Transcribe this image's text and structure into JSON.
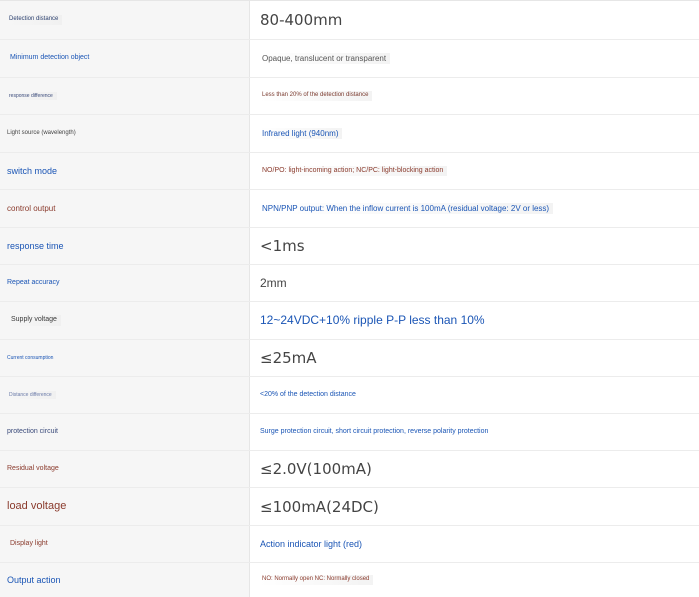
{
  "colors": {
    "blue": "#1a55b5",
    "brown": "#8a3a2c",
    "dark": "#333333"
  },
  "rows": [
    {
      "label": "Detection distance",
      "value": "80-400mm"
    },
    {
      "label": "Minimum detection object",
      "value": "Opaque, translucent or transparent"
    },
    {
      "label": "response difference",
      "value": "Less than 20% of the detection distance"
    },
    {
      "label": "Light source (wavelength)",
      "value": "Infrared light (940nm)"
    },
    {
      "label": "switch mode",
      "value": "NO/PO: light-incoming action; NC/PC: light-blocking action"
    },
    {
      "label": "control output",
      "value": "NPN/PNP output: When the inflow current is 100mA (residual voltage: 2V or less)"
    },
    {
      "label": "response time",
      "value": "<1ms"
    },
    {
      "label": "Repeat accuracy",
      "value": "2mm"
    },
    {
      "label": "Supply voltage",
      "value": "12~24VDC+10% ripple P-P less than 10%"
    },
    {
      "label": "Current consumption",
      "value": "≤25mA"
    },
    {
      "label": "Distance difference",
      "value": "<20% of the detection distance"
    },
    {
      "label": "protection circuit",
      "value": "Surge protection circuit, short circuit protection, reverse polarity protection"
    },
    {
      "label": "Residual voltage",
      "value": "≤2.0V(100mA)"
    },
    {
      "label": "load voltage",
      "value": "≤100mA(24DC)"
    },
    {
      "label": "Display light",
      "value": "Action indicator light (red)"
    },
    {
      "label": "Output action",
      "value": "NO: Normally open NC: Normally closed"
    }
  ]
}
